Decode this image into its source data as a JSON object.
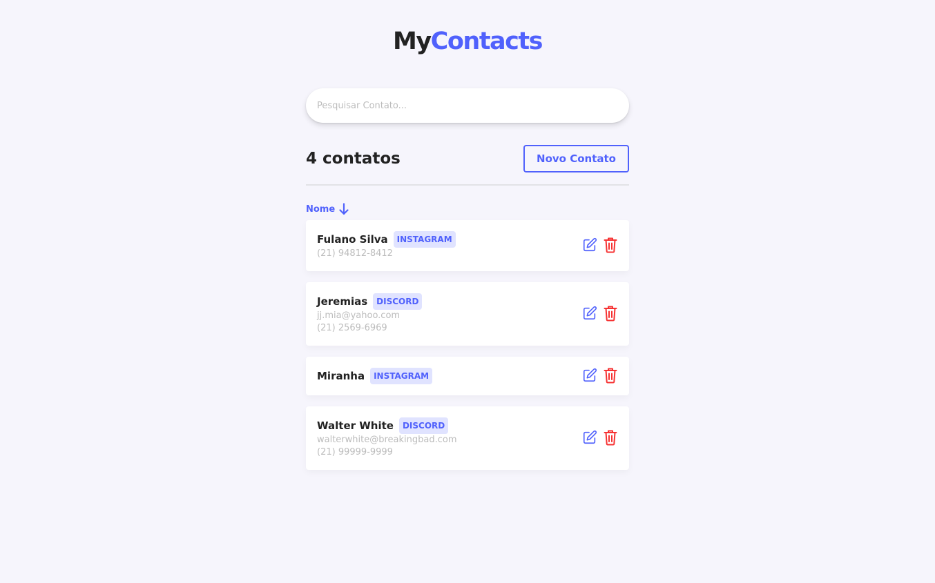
{
  "brand": {
    "part1": "My",
    "part2": "Contacts"
  },
  "search": {
    "placeholder": "Pesquisar Contato..."
  },
  "header": {
    "count_label": "4 contatos",
    "new_button": "Novo Contato"
  },
  "sort": {
    "label": "Nome",
    "direction": "arrow-down-icon"
  },
  "colors": {
    "primary": "#5061fc",
    "danger": "#f63131",
    "background": "#f6f5fc",
    "tag_bg": "#e0e3ff"
  },
  "contacts": [
    {
      "name": "Fulano Silva",
      "category": "INSTAGRAM",
      "email": "",
      "phone": "(21) 94812-8412"
    },
    {
      "name": "Jeremias",
      "category": "DISCORD",
      "email": "jj.mia@yahoo.com",
      "phone": "(21) 2569-6969"
    },
    {
      "name": "Miranha",
      "category": "INSTAGRAM",
      "email": "",
      "phone": ""
    },
    {
      "name": "Walter White",
      "category": "DISCORD",
      "email": "walterwhite@breakingbad.com",
      "phone": "(21) 99999-9999"
    }
  ]
}
